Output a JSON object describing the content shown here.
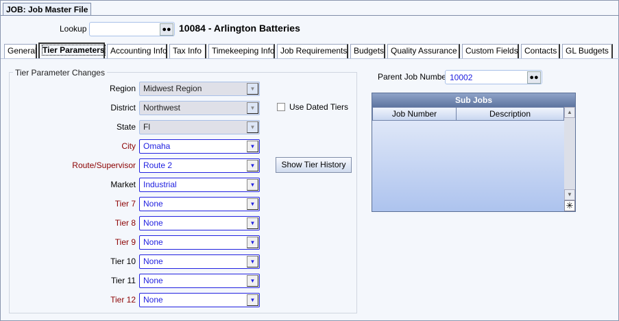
{
  "window": {
    "doc_tab": "JOB: Job Master File"
  },
  "lookup": {
    "label": "Lookup",
    "value": "",
    "title": "10084 - Arlington Batteries"
  },
  "tabs": [
    "General",
    "Tier Parameters",
    "Accounting Info",
    "Tax Info",
    "Timekeeping Info",
    "Job Requirements",
    "Budgets",
    "Quality Assurance",
    "Custom Fields",
    "Contacts",
    "GL Budgets"
  ],
  "active_tab": "Tier Parameters",
  "tier_group": {
    "title": "Tier Parameter Changes",
    "fields": [
      {
        "label": "Region",
        "value": "Midwest Region",
        "enabled": false
      },
      {
        "label": "District",
        "value": "Northwest",
        "enabled": false
      },
      {
        "label": "State",
        "value": "Fl",
        "enabled": false
      },
      {
        "label": "City",
        "value": "Omaha",
        "enabled": true,
        "required": true
      },
      {
        "label": "Route/Supervisor",
        "value": "Route 2",
        "enabled": true,
        "required": true
      },
      {
        "label": "Market",
        "value": "Industrial",
        "enabled": true,
        "required": false
      },
      {
        "label": "Tier 7",
        "value": "None",
        "enabled": true,
        "required": true
      },
      {
        "label": "Tier 8",
        "value": "None",
        "enabled": true,
        "required": true
      },
      {
        "label": "Tier 9",
        "value": "None",
        "enabled": true,
        "required": true
      },
      {
        "label": "Tier 10",
        "value": "None",
        "enabled": true,
        "required": false
      },
      {
        "label": "Tier 11",
        "value": "None",
        "enabled": true,
        "required": false
      },
      {
        "label": "Tier 12",
        "value": "None",
        "enabled": true,
        "required": true
      }
    ],
    "use_dated_tiers": {
      "label": "Use Dated Tiers",
      "checked": false
    },
    "show_history_label": "Show Tier History"
  },
  "parent_job": {
    "label": "Parent Job Number",
    "value": "10002"
  },
  "sub_jobs": {
    "title": "Sub Jobs",
    "columns": [
      "Job Number",
      "Description"
    ],
    "rows": []
  },
  "colors": {
    "required_label": "#8b0000",
    "enabled_value": "#2020e0",
    "grid_header": "#5e75a0"
  }
}
